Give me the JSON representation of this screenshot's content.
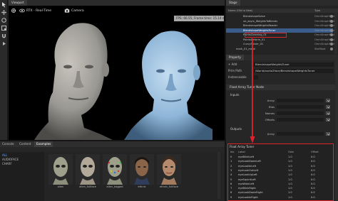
{
  "viewport": {
    "tab": "Viewport",
    "toolbar": {
      "rtx": "RTX - Real-Time",
      "camera": "Camera"
    },
    "fps": "FPS: 66.55, Frame time: 15.14 ms"
  },
  "bottom_panel": {
    "tabs": [
      "Console",
      "Content",
      "Examples"
    ],
    "sidebar": [
      "ALL",
      "AUDIOFACE",
      "CHARF"
    ],
    "thumbnails": [
      "alien",
      "alien_fullface",
      "alien_tagged",
      "ethnic",
      "ethnic_fullface"
    ]
  },
  "stage": {
    "tab": "Stage",
    "header_name": "Name (Old to New)",
    "header_type": "Type",
    "rows": [
      {
        "name": "BlendshapeSolve",
        "type": "OmniGraphNode",
        "indent": 24
      },
      {
        "name": "ue_asym_WeightsToBlends",
        "type": "OmniGraphNode",
        "indent": 24
      },
      {
        "name": "BlendshapeWeightsReader",
        "type": "OmniGraphNode",
        "indent": 24
      },
      {
        "name": "BlendshapeWeightsTuner",
        "type": "OmniGraphNode",
        "indent": 24,
        "selected": true
      },
      {
        "name": "PointsCleaning_01",
        "type": "OmniGraphNode",
        "indent": 24
      },
      {
        "name": "PointsDeform_01",
        "type": "OmniGraphNode",
        "indent": 24
      },
      {
        "name": "CurvySolver_01",
        "type": "OmniGraphNode",
        "indent": 24
      },
      {
        "name": "mark_01_mesh",
        "type": "SkelRoot",
        "indent": 14
      }
    ]
  },
  "property": {
    "tab": "Property",
    "add": "+ Add",
    "add_value": "BlendshapeWeightsTuner",
    "prim_path_label": "Prim Path",
    "prim_path": "/World/audio2face/BlendshapeWeightsTuner",
    "instanceable_label": "Instanceable",
    "section_float_array": "Float Array Tuner Node",
    "inputs": "Inputs",
    "fields": [
      "Array",
      "Bias",
      "Names",
      "Offsets"
    ],
    "outputs": "Outputs",
    "output_field": "Array"
  },
  "weights_table": {
    "title": "Float Array Tuner",
    "columns": [
      "Idx",
      "Label",
      "Gain",
      "Offset"
    ],
    "rows": [
      [
        "0",
        "eyeBlinkLeft",
        "1.0",
        "0.0"
      ],
      [
        "1",
        "eyeLookDownLeft",
        "1.0",
        "0.0"
      ],
      [
        "2",
        "eyeLookInLeft",
        "1.0",
        "0.0"
      ],
      [
        "3",
        "eyeLookOutLeft",
        "1.0",
        "0.0"
      ],
      [
        "4",
        "eyeLookUpLeft",
        "1.0",
        "0.0"
      ],
      [
        "5",
        "eyeSquintLeft",
        "1.0",
        "0.0"
      ],
      [
        "6",
        "eyeWideLeft",
        "1.0",
        "0.0"
      ],
      [
        "7",
        "eyeBlinkRight",
        "1.0",
        "0.0"
      ],
      [
        "8",
        "eyeLookDownRight",
        "1.0",
        "0.0"
      ],
      [
        "9",
        "eyeLookInRight",
        "1.0",
        "0.0"
      ]
    ]
  },
  "colors": {
    "highlight_red": "#e0222b",
    "selection_blue": "#3a5c8a",
    "grey_head": "#9a9893",
    "blue_head": "#8fb6d8"
  }
}
